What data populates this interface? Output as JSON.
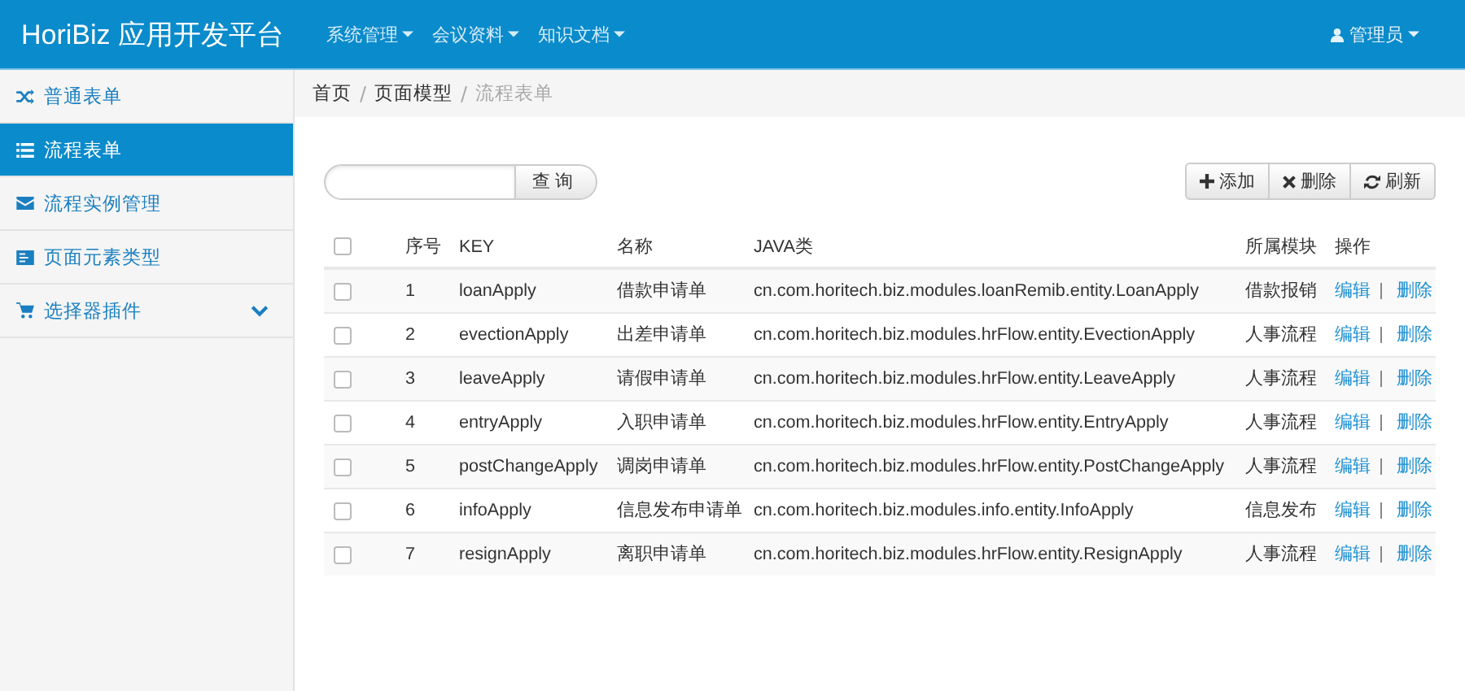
{
  "header": {
    "brand": "HoriBiz 应用开发平台",
    "menus": [
      {
        "label": "系统管理"
      },
      {
        "label": "会议资料"
      },
      {
        "label": "知识文档"
      }
    ],
    "user": "管理员"
  },
  "sidebar": {
    "items": [
      {
        "label": "普通表单",
        "selected": false,
        "expandable": false
      },
      {
        "label": "流程表单",
        "selected": true,
        "expandable": false
      },
      {
        "label": "流程实例管理",
        "selected": false,
        "expandable": false
      },
      {
        "label": "页面元素类型",
        "selected": false,
        "expandable": false
      },
      {
        "label": "选择器插件",
        "selected": false,
        "expandable": true
      }
    ]
  },
  "breadcrumb": [
    "首页",
    "页面模型",
    "流程表单"
  ],
  "search": {
    "button": "查 询"
  },
  "toolbar": [
    {
      "label": "添加"
    },
    {
      "label": "删除"
    },
    {
      "label": "刷新"
    }
  ],
  "table": {
    "select_all": {
      "checked": false
    },
    "columns": [
      "序号",
      "KEY",
      "名称",
      "JAVA类",
      "所属模块",
      "操作"
    ],
    "rows": [
      {
        "checked": false,
        "cells": [
          "1",
          "loanApply",
          "借款申请单",
          "cn.com.horitech.biz.modules.loanRemib.entity.LoanApply",
          "借款报销"
        ],
        "actions": [
          "编辑",
          "删除"
        ]
      },
      {
        "checked": false,
        "cells": [
          "2",
          "evectionApply",
          "出差申请单",
          "cn.com.horitech.biz.modules.hrFlow.entity.EvectionApply",
          "人事流程"
        ],
        "actions": [
          "编辑",
          "删除"
        ]
      },
      {
        "checked": false,
        "cells": [
          "3",
          "leaveApply",
          "请假申请单",
          "cn.com.horitech.biz.modules.hrFlow.entity.LeaveApply",
          "人事流程"
        ],
        "actions": [
          "编辑",
          "删除"
        ]
      },
      {
        "checked": false,
        "cells": [
          "4",
          "entryApply",
          "入职申请单",
          "cn.com.horitech.biz.modules.hrFlow.entity.EntryApply",
          "人事流程"
        ],
        "actions": [
          "编辑",
          "删除"
        ]
      },
      {
        "checked": false,
        "cells": [
          "5",
          "postChangeApply",
          "调岗申请单",
          "cn.com.horitech.biz.modules.hrFlow.entity.PostChangeApply",
          "人事流程"
        ],
        "actions": [
          "编辑",
          "删除"
        ]
      },
      {
        "checked": false,
        "cells": [
          "6",
          "infoApply",
          "信息发布申请单",
          "cn.com.horitech.biz.modules.info.entity.InfoApply",
          "信息发布"
        ],
        "actions": [
          "编辑",
          "删除"
        ]
      },
      {
        "checked": false,
        "cells": [
          "7",
          "resignApply",
          "离职申请单",
          "cn.com.horitech.biz.modules.hrFlow.entity.ResignApply",
          "人事流程"
        ],
        "actions": [
          "编辑",
          "删除"
        ]
      }
    ]
  }
}
